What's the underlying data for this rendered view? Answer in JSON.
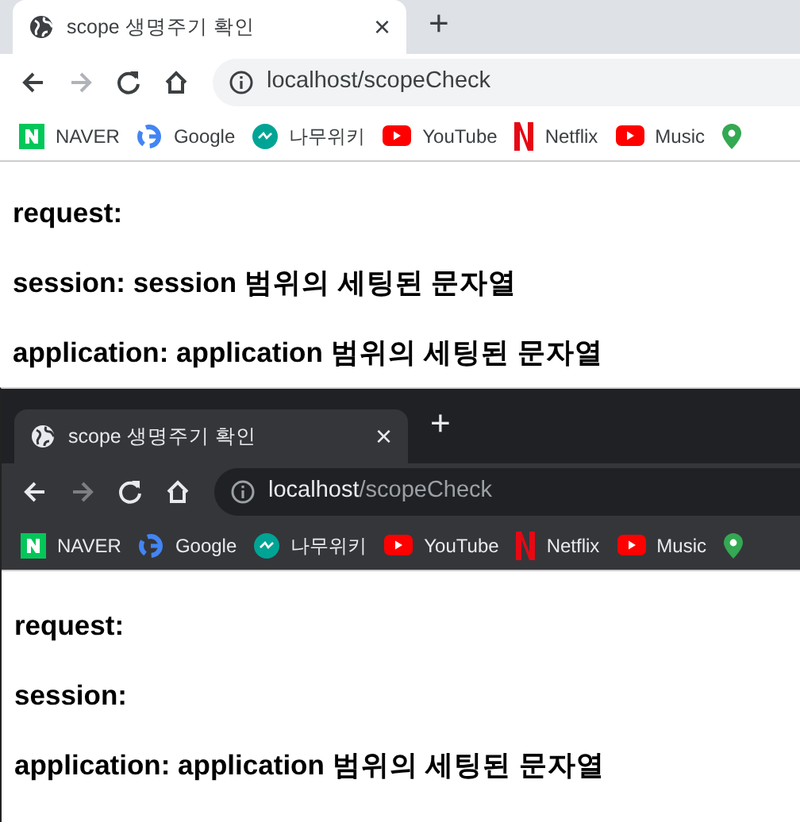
{
  "windows": [
    {
      "kind": "light",
      "tab": {
        "title": "scope 생명주기 확인",
        "close": "×"
      },
      "new_tab": "+",
      "url": {
        "host": "localhost",
        "path": "/scopeCheck"
      },
      "bookmarks": [
        {
          "kind": "naver",
          "label": "NAVER"
        },
        {
          "kind": "google",
          "label": "Google"
        },
        {
          "kind": "namu",
          "label": "나무위키"
        },
        {
          "kind": "youtube",
          "label": "YouTube"
        },
        {
          "kind": "netflix",
          "label": "Netflix"
        },
        {
          "kind": "youtube",
          "label": "Music"
        },
        {
          "kind": "maps"
        }
      ],
      "lines": [
        {
          "label": "request:"
        },
        {
          "label": "session:",
          "value": "session 범위의 세팅된 문자열"
        },
        {
          "label": "application:",
          "value": "application 범위의 세팅된 문자열"
        }
      ]
    },
    {
      "kind": "dark",
      "tab": {
        "title": "scope 생명주기 확인",
        "close": "×"
      },
      "new_tab": "+",
      "url": {
        "host": "localhost",
        "path": "/scopeCheck"
      },
      "bookmarks": [
        {
          "kind": "naver",
          "label": "NAVER"
        },
        {
          "kind": "google",
          "label": "Google"
        },
        {
          "kind": "namu",
          "label": "나무위키"
        },
        {
          "kind": "youtube",
          "label": "YouTube"
        },
        {
          "kind": "netflix",
          "label": "Netflix"
        },
        {
          "kind": "youtube",
          "label": "Music"
        },
        {
          "kind": "maps"
        }
      ],
      "lines": [
        {
          "label": "request:"
        },
        {
          "label": "session:"
        },
        {
          "label": "application:",
          "value": "application 범위의 세팅된 문자열"
        }
      ]
    }
  ]
}
